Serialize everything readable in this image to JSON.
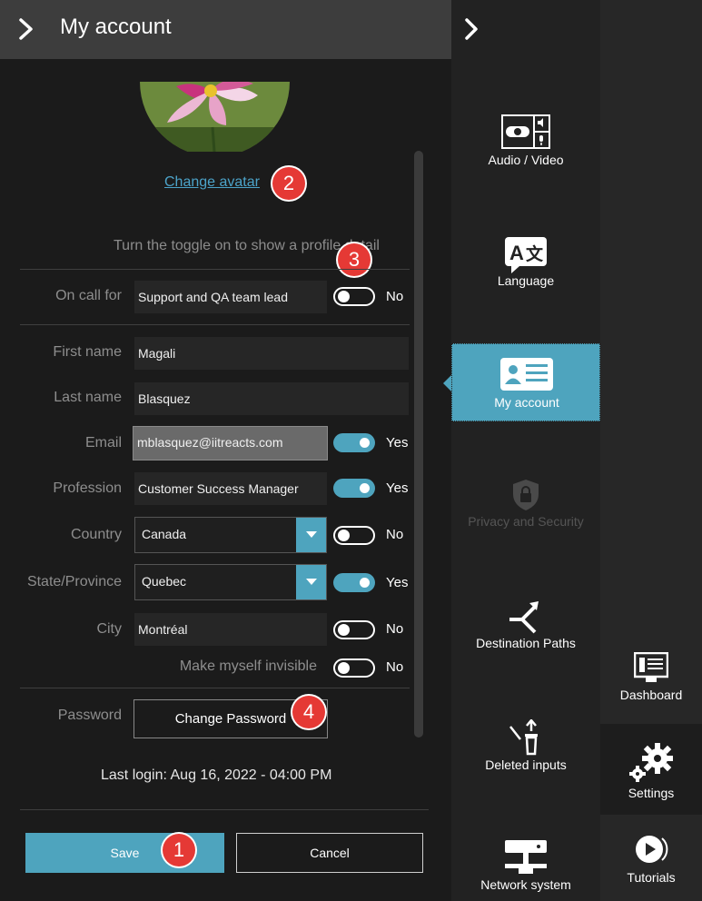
{
  "header": {
    "title": "My account"
  },
  "avatar": {
    "change_link": "Change avatar"
  },
  "hint": "Turn the toggle on to show a profile detail",
  "form": {
    "on_call": {
      "label": "On call for",
      "value": "Support and QA team lead",
      "toggle": "No"
    },
    "first_name": {
      "label": "First name",
      "value": "Magali"
    },
    "last_name": {
      "label": "Last name",
      "value": "Blasquez"
    },
    "email": {
      "label": "Email",
      "value": "mblasquez@iitreacts.com",
      "toggle": "Yes"
    },
    "profession": {
      "label": "Profession",
      "value": "Customer Success Manager",
      "toggle": "Yes"
    },
    "country": {
      "label": "Country",
      "value": "Canada",
      "toggle": "No"
    },
    "state": {
      "label": "State/Province",
      "value": "Quebec",
      "toggle": "Yes"
    },
    "city": {
      "label": "City",
      "value": "Montréal",
      "toggle": "No"
    },
    "invisible": {
      "label": "Make myself invisible",
      "toggle": "No"
    },
    "password": {
      "label": "Password",
      "button": "Change Password"
    }
  },
  "last_login": "Last login: Aug 16, 2022 - 04:00 PM",
  "actions": {
    "save": "Save",
    "cancel": "Cancel"
  },
  "badges": {
    "b1": "1",
    "b2": "2",
    "b3": "3",
    "b4": "4"
  },
  "nav": {
    "audio_video": "Audio / Video",
    "language": "Language",
    "my_account": "My account",
    "privacy": "Privacy and Security",
    "destination": "Destination Paths",
    "deleted": "Deleted inputs",
    "network": "Network system"
  },
  "side": {
    "dashboard": "Dashboard",
    "settings": "Settings",
    "tutorials": "Tutorials"
  },
  "colors": {
    "accent": "#4ea4be",
    "badge": "#e53935",
    "link": "#4ca3c9"
  }
}
